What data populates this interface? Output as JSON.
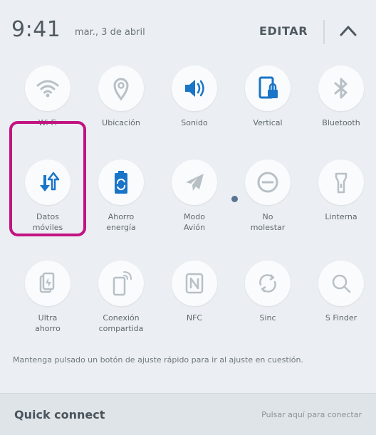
{
  "header": {
    "time": "9:41",
    "date": "mar., 3 de abril",
    "edit_label": "EDITAR"
  },
  "tiles": [
    {
      "label": "Wi-Fi",
      "icon": "wifi-icon"
    },
    {
      "label": "Ubicación",
      "icon": "location-icon"
    },
    {
      "label": "Sonido",
      "icon": "sound-icon"
    },
    {
      "label": "Vertical",
      "icon": "rotation-lock-icon"
    },
    {
      "label": "Bluetooth",
      "icon": "bluetooth-icon"
    },
    {
      "label": "Datos\nmóviles",
      "icon": "mobile-data-icon"
    },
    {
      "label": "Ahorro\nenergía",
      "icon": "battery-saver-icon"
    },
    {
      "label": "Modo\nAvión",
      "icon": "airplane-icon"
    },
    {
      "label": "No\nmolestar",
      "icon": "do-not-disturb-icon"
    },
    {
      "label": "Linterna",
      "icon": "flashlight-icon"
    },
    {
      "label": "Ultra\nahorro",
      "icon": "ultra-saving-icon"
    },
    {
      "label": "Conexión\ncompartida",
      "icon": "hotspot-icon"
    },
    {
      "label": "NFC",
      "icon": "nfc-icon"
    },
    {
      "label": "Sinc",
      "icon": "sync-icon"
    },
    {
      "label": "S Finder",
      "icon": "search-icon"
    }
  ],
  "hint": "Mantenga pulsado un botón de ajuste rápido para ir al ajuste en cuestión.",
  "quick_connect": {
    "title": "Quick connect",
    "action": "Pulsar aquí para conectar"
  },
  "colors": {
    "accent_blue": "#1a75c8",
    "highlight": "#c21381",
    "inactive": "#b8c0c6"
  }
}
